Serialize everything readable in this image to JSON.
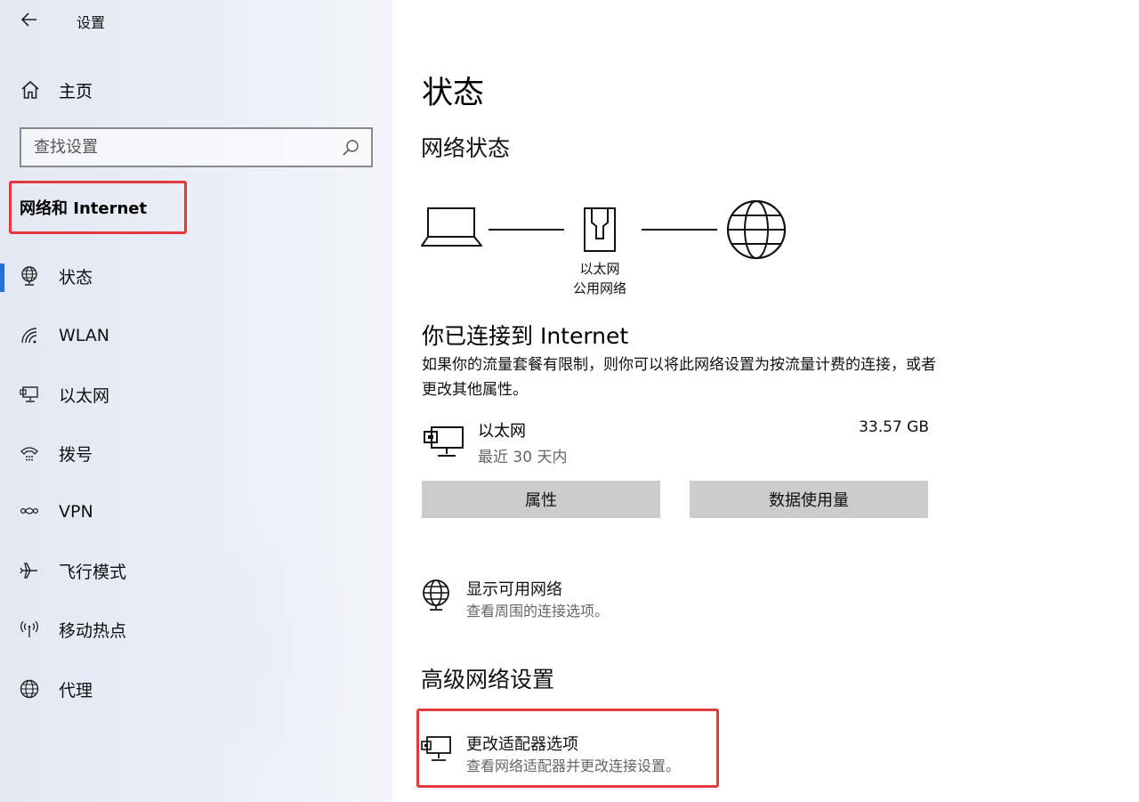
{
  "app": {
    "title": "设置"
  },
  "sidebar": {
    "home_label": "主页",
    "search_placeholder": "查找设置",
    "section_title": "网络和 Internet",
    "items": [
      {
        "label": "状态",
        "icon": "globe-network-icon",
        "selected": true
      },
      {
        "label": "WLAN",
        "icon": "wifi-icon"
      },
      {
        "label": "以太网",
        "icon": "ethernet-icon"
      },
      {
        "label": "拨号",
        "icon": "dialup-icon"
      },
      {
        "label": "VPN",
        "icon": "vpn-icon"
      },
      {
        "label": "飞行模式",
        "icon": "airplane-icon"
      },
      {
        "label": "移动热点",
        "icon": "hotspot-icon"
      },
      {
        "label": "代理",
        "icon": "globe-icon"
      }
    ]
  },
  "main": {
    "page_title": "状态",
    "network_status_heading": "网络状态",
    "diagram": {
      "adapter_name": "以太网",
      "network_type": "公用网络"
    },
    "connected_title": "你已连接到 Internet",
    "description": "如果你的流量套餐有限制，则你可以将此网络设置为按流量计费的连接，或者更改其他属性。",
    "adapter": {
      "name": "以太网",
      "period": "最近 30 天内",
      "usage": "33.57 GB"
    },
    "buttons": {
      "properties": "属性",
      "data_usage": "数据使用量"
    },
    "show_networks": {
      "title": "显示可用网络",
      "subtitle": "查看周围的连接选项。"
    },
    "advanced_heading": "高级网络设置",
    "change_adapter": {
      "title": "更改适配器选项",
      "subtitle": "查看网络适配器并更改连接设置。"
    }
  },
  "colors": {
    "accent": "#2a6fd6",
    "highlight": "#e0393e",
    "button_bg": "#cccccc"
  }
}
